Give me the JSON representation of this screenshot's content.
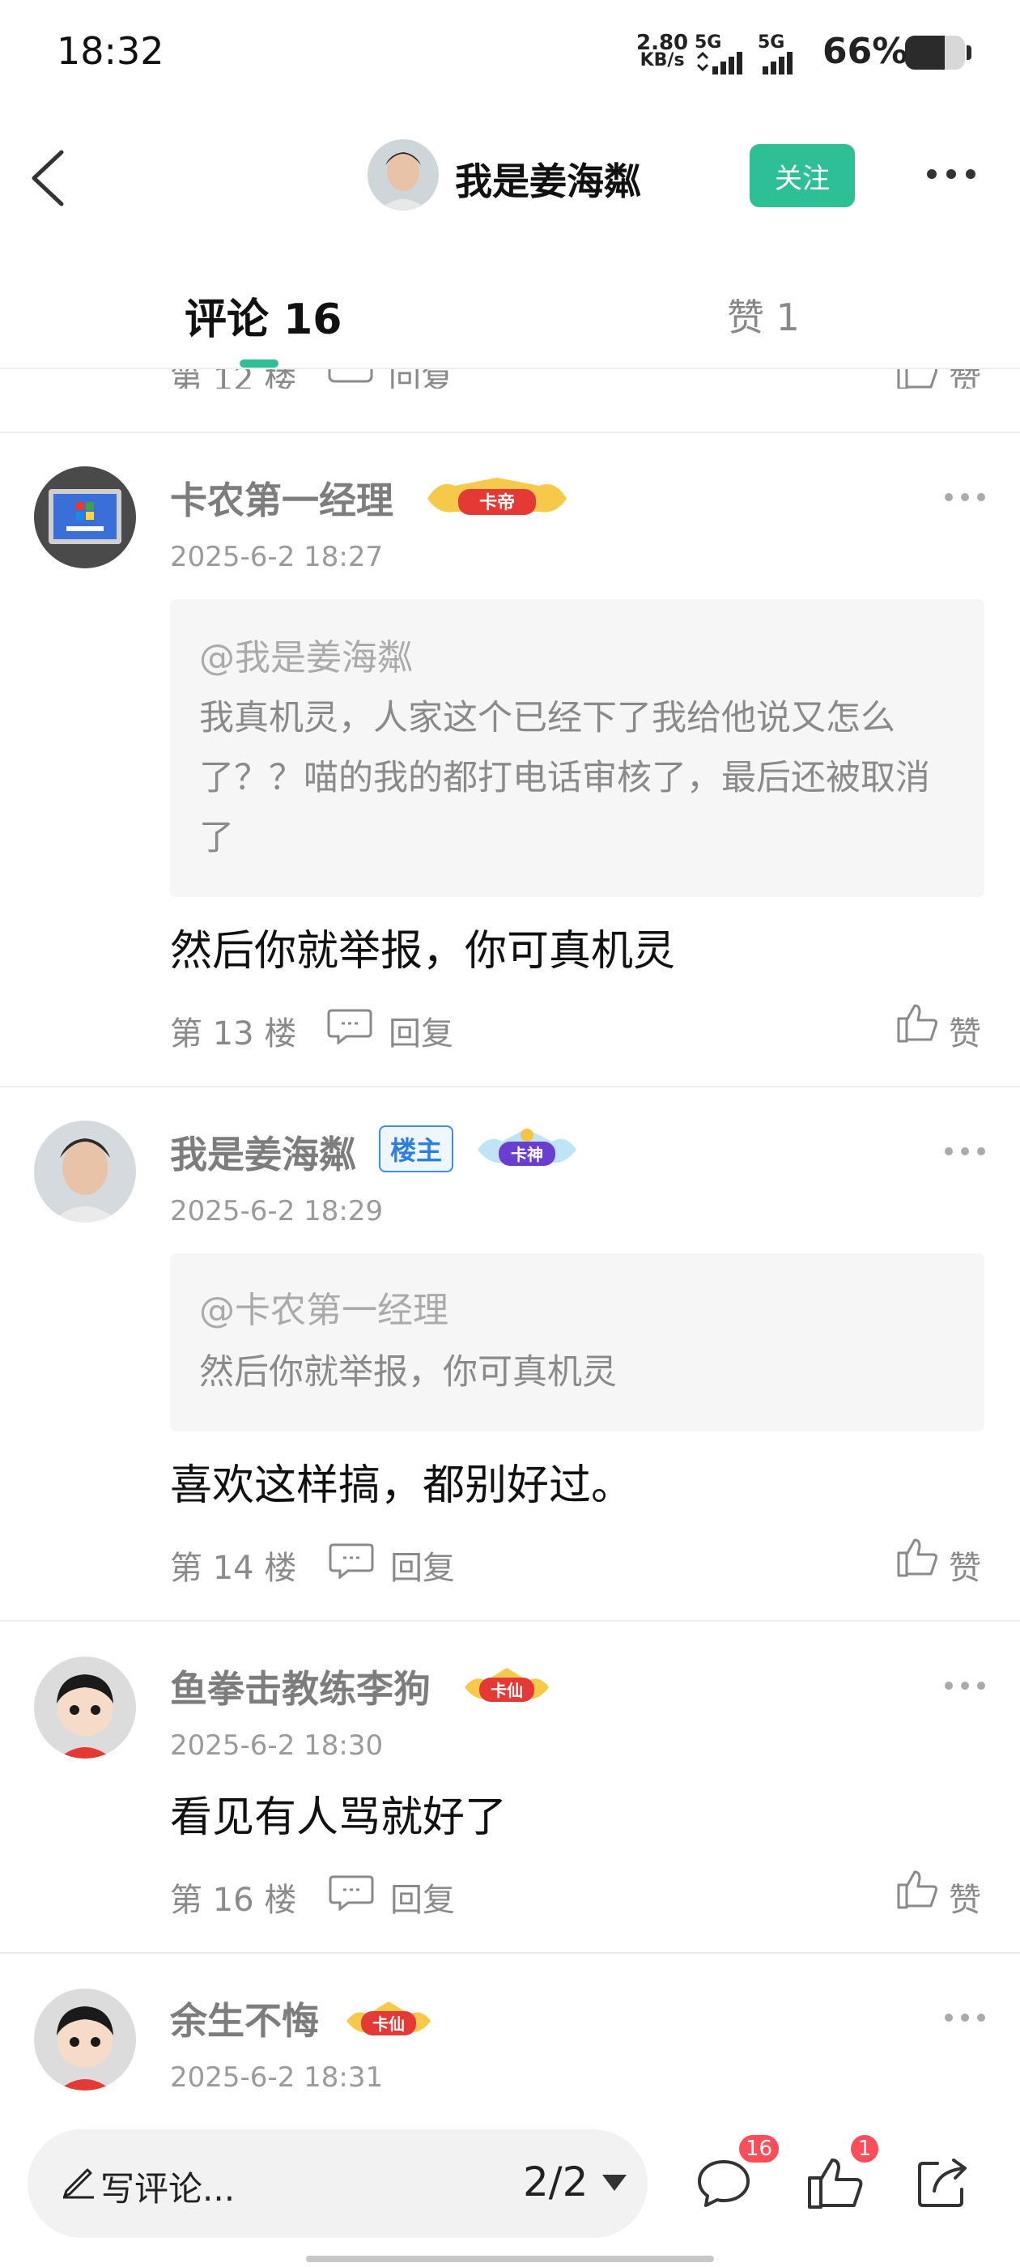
{
  "status_bar": {
    "time": "18:32",
    "net_speed_value": "2.80",
    "net_speed_unit": "KB/s",
    "signal1_label": "5G",
    "signal2_label": "5G",
    "battery_percent": "66%",
    "battery_level": 0.66
  },
  "header": {
    "username": "我是姜海粼",
    "follow_label": "关注"
  },
  "tabs": {
    "comments": "评论 16",
    "likes": "赞 1"
  },
  "partial_row": {
    "floor": "第 12 楼",
    "reply": "回复",
    "like": "赞"
  },
  "comments": [
    {
      "username": "卡农第一经理",
      "badge": "卡帝",
      "time": "2025-6-2 18:27",
      "quote_at": "@我是姜海粼",
      "quote_text": "我真机灵，人家这个已经下了我给他说又怎么了？？喵的我的都打电话审核了，最后还被取消了",
      "text": "然后你就举报，你可真机灵",
      "floor": "第 13 楼",
      "reply": "回复",
      "like": "赞"
    },
    {
      "username": "我是姜海粼",
      "owner_badge": "楼主",
      "badge": "卡神",
      "time": "2025-6-2 18:29",
      "quote_at": "@卡农第一经理",
      "quote_text": "然后你就举报，你可真机灵",
      "text": "喜欢这样搞，都别好过。",
      "floor": "第 14 楼",
      "reply": "回复",
      "like": "赞"
    },
    {
      "username": "鱼拳击教练李狗",
      "badge": "卡仙",
      "time": "2025-6-2 18:30",
      "text": "看见有人骂就好了",
      "floor": "第 16 楼",
      "reply": "回复",
      "like": "赞"
    },
    {
      "username": "余生不悔",
      "badge": "卡仙",
      "time": "2025-6-2 18:31"
    }
  ],
  "bottom_bar": {
    "write_placeholder": "写评论...",
    "page_indicator": "2/2",
    "comment_count": "16",
    "like_count": "1"
  },
  "colors": {
    "accent": "#2fbf96",
    "badge_red": "#ff4d5a",
    "owner_blue": "#2c7fe0"
  },
  "icons": [
    "back-icon",
    "more-icon",
    "reply-icon",
    "thumbs-up-icon",
    "pen-icon",
    "caret-down-icon",
    "comment-bubble-icon",
    "share-icon"
  ]
}
